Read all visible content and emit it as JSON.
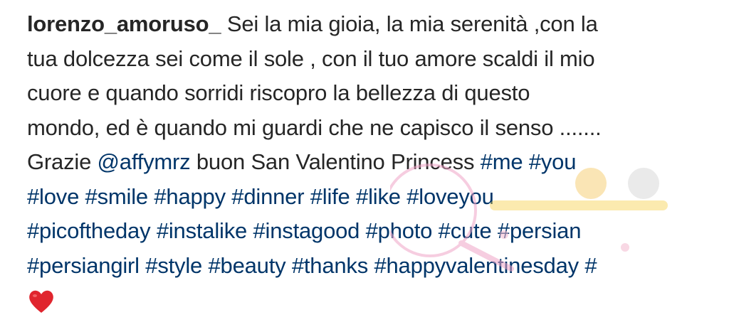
{
  "post": {
    "username": "lorenzo_amoruso_",
    "caption_lines": [
      "Sei la mia gioia, la mia serenità ,con la",
      "tua dolcezza sei come il sole , con il tuo amore scaldi il mio",
      "cuore e quando sorridi riscopro la bellezza di questo",
      "mondo, ed è quando mi guardi che ne capisco il senso ......."
    ],
    "thanks_prefix": "Grazie ",
    "mention": "@affymrz",
    "thanks_suffix": " buon San Valentino Princess  ",
    "hashtags_line5": [
      "#me",
      "#you"
    ],
    "hashtags_line6": [
      "#love",
      "#smile",
      "#happy",
      "#dinner",
      "#life",
      "#like",
      "#loveyou"
    ],
    "hashtags_line7": [
      "#picoftheday",
      "#instalike",
      "#instagood",
      "#photo",
      "#cute",
      "#persian"
    ],
    "hashtags_line8": [
      "#persiangirl",
      "#style",
      "#beauty",
      "#thanks",
      "#happyvalentinesday",
      "#"
    ],
    "emoji": "red-heart-icon"
  },
  "colors": {
    "text": "#262626",
    "link": "#003569",
    "heart": "#e0252e"
  }
}
